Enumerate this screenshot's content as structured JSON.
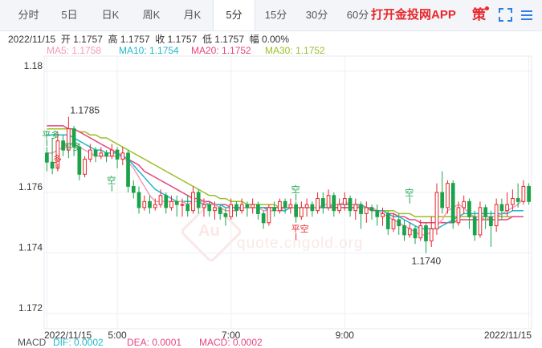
{
  "tabs": [
    {
      "label": "分时"
    },
    {
      "label": "5日"
    },
    {
      "label": "日K"
    },
    {
      "label": "周K"
    },
    {
      "label": "月K"
    },
    {
      "label": "5分"
    },
    {
      "label": "15分"
    },
    {
      "label": "30分"
    },
    {
      "label": "60分"
    }
  ],
  "active_tab": "5分",
  "app_link": "打开金投网APP",
  "strategy_label": "策",
  "ohlc": {
    "text": "2022/11/15  开 1.1757  高 1.1757  收 1.1757  低 1.1757  幅 0.00%"
  },
  "ma": [
    {
      "label": "MA5: 1.1758",
      "color": "#f39bb6"
    },
    {
      "label": "MA10: 1.1754",
      "color": "#1fb8cf"
    },
    {
      "label": "MA20: 1.1752",
      "color": "#e8457c"
    },
    {
      "label": "MA30: 1.1752",
      "color": "#9cbf2a"
    }
  ],
  "macd": [
    {
      "label": "MACD",
      "color": "#555555"
    },
    {
      "label": "DIF: 0.0002",
      "color": "#1fb8cf"
    },
    {
      "label": "DEA: 0.0001",
      "color": "#e8457c"
    },
    {
      "label": "MACD: 0.0002",
      "color": "#e8457c"
    }
  ],
  "watermark": {
    "text": "quote.cngold.org",
    "logo": "Au"
  },
  "chart_data": {
    "type": "candlestick",
    "y_ticks": [
      "1.18",
      "1.176",
      "1.174",
      "1.172"
    ],
    "x_ticks": [
      "2022/11/15",
      "5:00",
      "7:00",
      "9:00",
      "2022/11/15"
    ],
    "ylim": [
      1.1715,
      1.1805
    ],
    "high_label": "1.1785",
    "low_label": "1.1740",
    "signals": [
      "平多",
      "多",
      "平多",
      "空",
      "空",
      "平空",
      "空"
    ],
    "colors": {
      "up": "#e8262b",
      "down": "#1aa34a"
    },
    "candles": [
      [
        1.1773,
        1.177,
        1.1775,
        1.1767
      ],
      [
        1.177,
        1.1768,
        1.1778,
        1.1766
      ],
      [
        1.1768,
        1.1777,
        1.178,
        1.1767
      ],
      [
        1.1777,
        1.1774,
        1.1779,
        1.1772
      ],
      [
        1.1774,
        1.1781,
        1.1785,
        1.1773
      ],
      [
        1.1781,
        1.1775,
        1.1782,
        1.1772
      ],
      [
        1.1775,
        1.1766,
        1.1776,
        1.1764
      ],
      [
        1.1766,
        1.1771,
        1.1772,
        1.1765
      ],
      [
        1.1771,
        1.1774,
        1.1776,
        1.177
      ],
      [
        1.1774,
        1.1772,
        1.1775,
        1.177
      ],
      [
        1.1772,
        1.1773,
        1.1775,
        1.1771
      ],
      [
        1.1773,
        1.1772,
        1.1774,
        1.177
      ],
      [
        1.1772,
        1.1774,
        1.1776,
        1.1771
      ],
      [
        1.1774,
        1.1771,
        1.1775,
        1.1768
      ],
      [
        1.1771,
        1.1773,
        1.1775,
        1.1769
      ],
      [
        1.1773,
        1.1762,
        1.1774,
        1.176
      ],
      [
        1.1762,
        1.176,
        1.1764,
        1.1758
      ],
      [
        1.176,
        1.1755,
        1.1762,
        1.1753
      ],
      [
        1.1755,
        1.1757,
        1.1759,
        1.1754
      ],
      [
        1.1757,
        1.1755,
        1.1759,
        1.1753
      ],
      [
        1.1755,
        1.1756,
        1.1758,
        1.1754
      ],
      [
        1.1756,
        1.1759,
        1.1761,
        1.1755
      ],
      [
        1.1759,
        1.1755,
        1.176,
        1.1753
      ],
      [
        1.1755,
        1.1757,
        1.1759,
        1.1754
      ],
      [
        1.1757,
        1.1756,
        1.1759,
        1.1752
      ],
      [
        1.1756,
        1.1756,
        1.1758,
        1.1752
      ],
      [
        1.1756,
        1.1754,
        1.1759,
        1.1752
      ],
      [
        1.1754,
        1.176,
        1.1762,
        1.1753
      ],
      [
        1.176,
        1.1755,
        1.1761,
        1.1753
      ],
      [
        1.1755,
        1.1756,
        1.1758,
        1.1752
      ],
      [
        1.1756,
        1.1754,
        1.1757,
        1.1752
      ],
      [
        1.1754,
        1.1755,
        1.1757,
        1.1751
      ],
      [
        1.1755,
        1.1753,
        1.1756,
        1.1751
      ],
      [
        1.1753,
        1.1752,
        1.1755,
        1.1749
      ],
      [
        1.1752,
        1.1756,
        1.1758,
        1.1751
      ],
      [
        1.1756,
        1.1754,
        1.1757,
        1.1752
      ],
      [
        1.1754,
        1.1756,
        1.1758,
        1.1753
      ],
      [
        1.1756,
        1.1755,
        1.1757,
        1.1752
      ],
      [
        1.1755,
        1.1756,
        1.1758,
        1.1753
      ],
      [
        1.1756,
        1.1753,
        1.1757,
        1.1751
      ],
      [
        1.1753,
        1.175,
        1.1754,
        1.1748
      ],
      [
        1.175,
        1.1755,
        1.1756,
        1.1749
      ],
      [
        1.1755,
        1.1754,
        1.1757,
        1.1752
      ],
      [
        1.1754,
        1.1757,
        1.1758,
        1.1753
      ],
      [
        1.1757,
        1.1755,
        1.1758,
        1.1753
      ],
      [
        1.1755,
        1.1756,
        1.1758,
        1.1753
      ],
      [
        1.1756,
        1.1752,
        1.1757,
        1.175
      ],
      [
        1.1752,
        1.1755,
        1.1757,
        1.1751
      ],
      [
        1.1755,
        1.1756,
        1.1758,
        1.1752
      ],
      [
        1.1756,
        1.1754,
        1.1757,
        1.1752
      ],
      [
        1.1754,
        1.1758,
        1.176,
        1.1753
      ],
      [
        1.1758,
        1.1755,
        1.176,
        1.1753
      ],
      [
        1.1755,
        1.1759,
        1.1761,
        1.1754
      ],
      [
        1.1759,
        1.1754,
        1.176,
        1.1752
      ],
      [
        1.1754,
        1.1756,
        1.1758,
        1.1753
      ],
      [
        1.1756,
        1.1758,
        1.176,
        1.1754
      ],
      [
        1.1758,
        1.1754,
        1.1759,
        1.1752
      ],
      [
        1.1754,
        1.1756,
        1.1758,
        1.1751
      ],
      [
        1.1756,
        1.1753,
        1.1757,
        1.1748
      ],
      [
        1.1753,
        1.1755,
        1.1757,
        1.175
      ],
      [
        1.1755,
        1.1754,
        1.1756,
        1.1751
      ],
      [
        1.1754,
        1.1752,
        1.1756,
        1.1749
      ],
      [
        1.1752,
        1.1753,
        1.1755,
        1.1749
      ],
      [
        1.1753,
        1.1748,
        1.1754,
        1.1746
      ],
      [
        1.1748,
        1.1751,
        1.1753,
        1.1747
      ],
      [
        1.1751,
        1.1749,
        1.1753,
        1.1746
      ],
      [
        1.1749,
        1.1746,
        1.1751,
        1.1744
      ],
      [
        1.1746,
        1.1748,
        1.175,
        1.1745
      ],
      [
        1.1748,
        1.1745,
        1.1749,
        1.1743
      ],
      [
        1.1745,
        1.1749,
        1.1751,
        1.1744
      ],
      [
        1.1749,
        1.1744,
        1.175,
        1.174
      ],
      [
        1.1744,
        1.1748,
        1.1752,
        1.1742
      ],
      [
        1.1748,
        1.176,
        1.1763,
        1.1746
      ],
      [
        1.176,
        1.1755,
        1.1767,
        1.1753
      ],
      [
        1.1755,
        1.1763,
        1.1764,
        1.1753
      ],
      [
        1.1763,
        1.175,
        1.1764,
        1.1748
      ],
      [
        1.175,
        1.1755,
        1.1757,
        1.1749
      ],
      [
        1.1755,
        1.1757,
        1.1759,
        1.1753
      ],
      [
        1.1757,
        1.1752,
        1.1758,
        1.1748
      ],
      [
        1.1752,
        1.1746,
        1.1754,
        1.1744
      ],
      [
        1.1746,
        1.1755,
        1.1757,
        1.1745
      ],
      [
        1.1755,
        1.1752,
        1.1756,
        1.1748
      ],
      [
        1.1752,
        1.1749,
        1.1754,
        1.1742
      ],
      [
        1.1749,
        1.1756,
        1.1758,
        1.1747
      ],
      [
        1.1756,
        1.1754,
        1.1758,
        1.1751
      ],
      [
        1.1754,
        1.1756,
        1.176,
        1.1752
      ],
      [
        1.1756,
        1.1758,
        1.1761,
        1.1754
      ],
      [
        1.1758,
        1.1757,
        1.1763,
        1.1755
      ],
      [
        1.1757,
        1.1762,
        1.1764,
        1.1756
      ],
      [
        1.1762,
        1.1757,
        1.1763,
        1.1756
      ]
    ],
    "ma5": [
      1.1773,
      1.1773,
      1.1774,
      1.1775,
      1.1776,
      1.1776,
      1.1775,
      1.1774,
      1.1773,
      1.1772,
      1.1772,
      1.1772,
      1.1772,
      1.1772,
      1.1772,
      1.177,
      1.1768,
      1.1765,
      1.1762,
      1.1759,
      1.1757,
      1.1757,
      1.1757,
      1.1757,
      1.1757,
      1.1757,
      1.1756,
      1.1757,
      1.1757,
      1.1757,
      1.1756,
      1.1756,
      1.1755,
      1.1754,
      1.1754,
      1.1754,
      1.1755,
      1.1755,
      1.1755,
      1.1755,
      1.1754,
      1.1754,
      1.1754,
      1.1754,
      1.1755,
      1.1755,
      1.1755,
      1.1755,
      1.1755,
      1.1755,
      1.1755,
      1.1756,
      1.1756,
      1.1756,
      1.1756,
      1.1757,
      1.1756,
      1.1756,
      1.1755,
      1.1755,
      1.1755,
      1.1754,
      1.1753,
      1.1752,
      1.1751,
      1.175,
      1.1749,
      1.1748,
      1.1747,
      1.1746,
      1.1746,
      1.1747,
      1.1749,
      1.1751,
      1.1754,
      1.1755,
      1.1756,
      1.1755,
      1.1753,
      1.1752,
      1.1752,
      1.1751,
      1.1752,
      1.1752,
      1.1753,
      1.1754,
      1.1755,
      1.1756,
      1.1758
    ],
    "ma10": [
      1.1779,
      1.1779,
      1.1779,
      1.1779,
      1.1779,
      1.1778,
      1.1777,
      1.1776,
      1.1775,
      1.1774,
      1.1774,
      1.1773,
      1.1773,
      1.1773,
      1.1772,
      1.1771,
      1.1769,
      1.1767,
      1.1765,
      1.1763,
      1.1761,
      1.176,
      1.1759,
      1.1758,
      1.1757,
      1.1757,
      1.1757,
      1.1757,
      1.1757,
      1.1756,
      1.1756,
      1.1756,
      1.1756,
      1.1755,
      1.1755,
      1.1755,
      1.1755,
      1.1755,
      1.1755,
      1.1755,
      1.1755,
      1.1754,
      1.1754,
      1.1754,
      1.1754,
      1.1755,
      1.1755,
      1.1755,
      1.1755,
      1.1755,
      1.1755,
      1.1755,
      1.1755,
      1.1756,
      1.1756,
      1.1756,
      1.1756,
      1.1756,
      1.1756,
      1.1755,
      1.1755,
      1.1754,
      1.1754,
      1.1753,
      1.1752,
      1.1752,
      1.1751,
      1.175,
      1.1749,
      1.1748,
      1.1748,
      1.1748,
      1.1748,
      1.1749,
      1.175,
      1.1751,
      1.1752,
      1.1753,
      1.1753,
      1.1753,
      1.1753,
      1.1753,
      1.1753,
      1.1753,
      1.1753,
      1.1753,
      1.1754,
      1.1754,
      1.1754
    ],
    "ma20": [
      1.1782,
      1.1782,
      1.1782,
      1.1782,
      1.1781,
      1.1781,
      1.178,
      1.1779,
      1.1778,
      1.1777,
      1.1776,
      1.1775,
      1.1774,
      1.1773,
      1.1772,
      1.1771,
      1.177,
      1.1769,
      1.1767,
      1.1766,
      1.1765,
      1.1764,
      1.1763,
      1.1762,
      1.1761,
      1.176,
      1.1759,
      1.1758,
      1.1758,
      1.1757,
      1.1757,
      1.1756,
      1.1756,
      1.1756,
      1.1755,
      1.1755,
      1.1755,
      1.1755,
      1.1755,
      1.1755,
      1.1755,
      1.1755,
      1.1755,
      1.1755,
      1.1755,
      1.1755,
      1.1755,
      1.1755,
      1.1755,
      1.1755,
      1.1755,
      1.1755,
      1.1755,
      1.1755,
      1.1755,
      1.1755,
      1.1755,
      1.1755,
      1.1755,
      1.1755,
      1.1754,
      1.1754,
      1.1754,
      1.1753,
      1.1753,
      1.1752,
      1.1752,
      1.1751,
      1.1751,
      1.175,
      1.175,
      1.175,
      1.175,
      1.175,
      1.175,
      1.175,
      1.1751,
      1.1751,
      1.1751,
      1.1751,
      1.1751,
      1.1751,
      1.1751,
      1.1751,
      1.1751,
      1.1751,
      1.1752,
      1.1752,
      1.1752
    ],
    "ma30": [
      1.1781,
      1.1781,
      1.1781,
      1.1781,
      1.1781,
      1.1781,
      1.178,
      1.178,
      1.1779,
      1.1779,
      1.1778,
      1.1778,
      1.1777,
      1.1776,
      1.1775,
      1.1774,
      1.1773,
      1.1772,
      1.1771,
      1.177,
      1.1769,
      1.1768,
      1.1767,
      1.1766,
      1.1765,
      1.1764,
      1.1763,
      1.1762,
      1.1761,
      1.176,
      1.1759,
      1.1759,
      1.1758,
      1.1758,
      1.1757,
      1.1757,
      1.1757,
      1.1756,
      1.1756,
      1.1756,
      1.1756,
      1.1756,
      1.1756,
      1.1755,
      1.1755,
      1.1755,
      1.1755,
      1.1755,
      1.1755,
      1.1755,
      1.1755,
      1.1755,
      1.1755,
      1.1755,
      1.1755,
      1.1755,
      1.1755,
      1.1755,
      1.1755,
      1.1755,
      1.1755,
      1.1754,
      1.1754,
      1.1754,
      1.1754,
      1.1753,
      1.1753,
      1.1753,
      1.1752,
      1.1752,
      1.1752,
      1.1752,
      1.1752,
      1.1752,
      1.1752,
      1.1752,
      1.1752,
      1.1752,
      1.1752,
      1.1752,
      1.1752,
      1.1752,
      1.1752,
      1.1752,
      1.1752,
      1.1752,
      1.1752,
      1.1752,
      1.1752
    ]
  }
}
